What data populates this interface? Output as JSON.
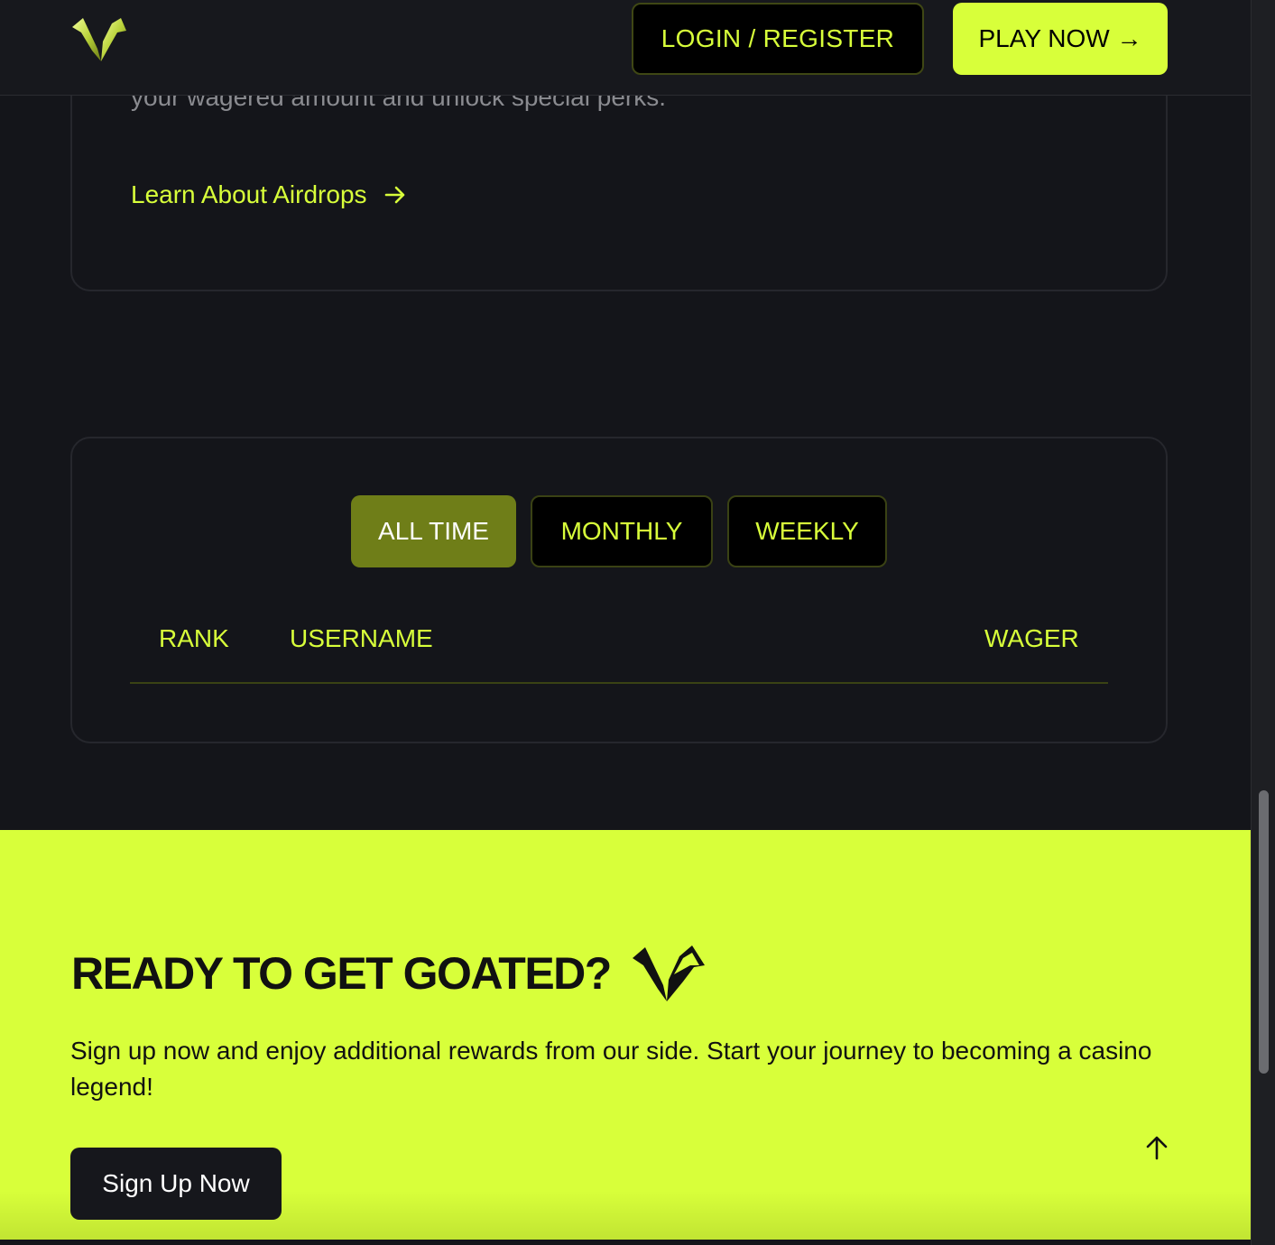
{
  "header": {
    "login_label": "LOGIN / REGISTER",
    "play_label": "PLAY NOW →"
  },
  "airdrop": {
    "description": "your wagered amount and unlock special perks.",
    "link_label": "Learn About Airdrops"
  },
  "leaderboard": {
    "tabs": [
      {
        "label": "ALL TIME",
        "active": true
      },
      {
        "label": "MONTHLY",
        "active": false
      },
      {
        "label": "WEEKLY",
        "active": false
      }
    ],
    "columns": {
      "rank": "RANK",
      "username": "USERNAME",
      "wager": "WAGER"
    },
    "rows": []
  },
  "cta": {
    "title": "READY TO GET GOATED?",
    "description": "Sign up now and enjoy additional rewards from our side. Start your journey to becoming a casino legend!",
    "button_label": "Sign Up Now"
  },
  "colors": {
    "accent": "#d8ff3a",
    "background": "#14151a",
    "active_tab": "#6f7e18"
  },
  "icons": {
    "logo": "goat-horns-logo-icon",
    "link_arrow": "arrow-right-icon",
    "scroll_top": "arrow-up-icon"
  }
}
